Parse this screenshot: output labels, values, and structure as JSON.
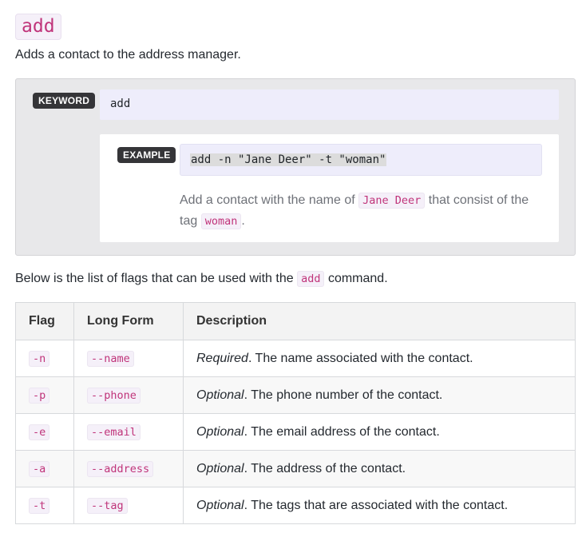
{
  "heading": "add",
  "intro": "Adds a contact to the address manager.",
  "keyword": {
    "tag": "KEYWORD",
    "value": "add"
  },
  "example": {
    "tag": "EXAMPLE",
    "command": "add -n \"Jane Deer\" -t \"woman\"",
    "desc_before": "Add a contact with the name of",
    "name_value": "Jane Deer",
    "desc_middle": "that consist of the tag",
    "tag_value": "woman",
    "desc_end": "."
  },
  "flags_sentence": {
    "before": "Below is the list of flags that can be used with the",
    "code": "add",
    "after": "command."
  },
  "table": {
    "headers": [
      "Flag",
      "Long Form",
      "Description"
    ],
    "rows": [
      {
        "flag": "-n",
        "long": "--name",
        "qualifier": "Required",
        "desc": ". The name associated with the contact."
      },
      {
        "flag": "-p",
        "long": "--phone",
        "qualifier": "Optional",
        "desc": ". The phone number of the contact."
      },
      {
        "flag": "-e",
        "long": "--email",
        "qualifier": "Optional",
        "desc": ". The email address of the contact."
      },
      {
        "flag": "-a",
        "long": "--address",
        "qualifier": "Optional",
        "desc": ". The address of the contact."
      },
      {
        "flag": "-t",
        "long": "--tag",
        "qualifier": "Optional",
        "desc": ". The tags that are associated with the contact."
      }
    ]
  }
}
